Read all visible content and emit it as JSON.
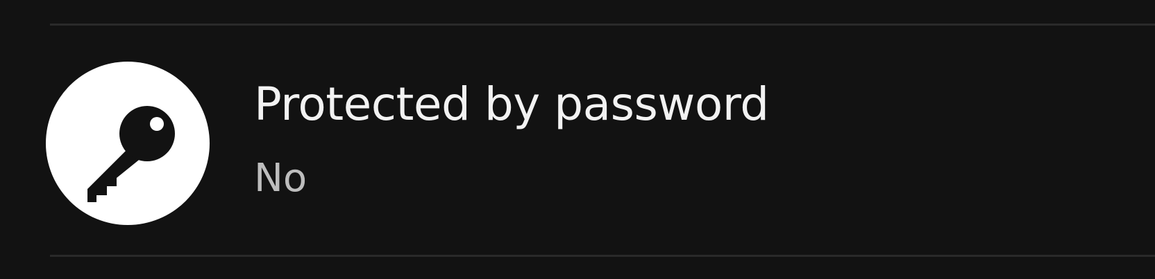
{
  "setting": {
    "icon": "key-icon",
    "title": "Protected by password",
    "value": "No"
  },
  "colors": {
    "background": "#121212",
    "icon_circle": "#ffffff",
    "icon_glyph": "#121212",
    "title_text": "#f2f2f2",
    "value_text": "#bdbdbd",
    "divider": "#2a2a2a"
  }
}
